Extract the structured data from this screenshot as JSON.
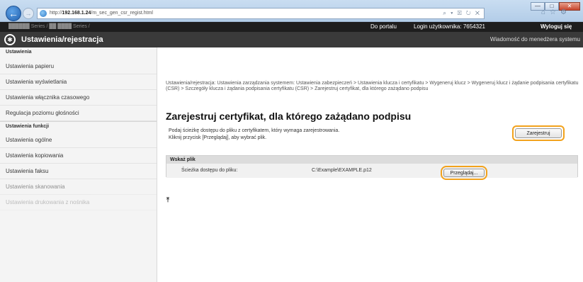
{
  "browser": {
    "url_prefix": "http://",
    "url_host": "192.168.1.24",
    "url_path": "/m_sec_gen_csr_regist.html",
    "address_tools": "⌕ ▾ ☒ ↻ ✕",
    "window_min": "—",
    "window_max": "□",
    "window_close": "✕"
  },
  "topbar": {
    "blurred_text": "██████ Series / ██ ████ Series /",
    "portal_link": "Do portalu",
    "login_label": "Login użytkownika:  7654321",
    "logout_link": "Wyloguj się"
  },
  "header": {
    "title": "Ustawienia/rejestracja",
    "message_link": "Wiadomość do menedżera systemu"
  },
  "sidebar": {
    "section_settings": "Ustawienia",
    "items_settings": [
      "Ustawienia papieru",
      "Ustawienia wyświetlania",
      "Ustawienia włącznika czasowego",
      "Regulacja poziomu głośności"
    ],
    "section_functions": "Ustawienia funkcji",
    "items_functions": [
      "Ustawienia ogólne",
      "Ustawienia kopiowania",
      "Ustawienia faksu",
      "Ustawienia skanowania",
      "Ustawienia drukowania z nośnika"
    ]
  },
  "main": {
    "breadcrumb": "Ustawienia/rejestracja: Ustawienia zarządzania systemem: Ustawienia zabezpieczeń > Ustawienia klucza i certyfikatu > Wygeneruj klucz > Wygeneruj klucz i żądanie podpisania certyfikatu (CSR) > Szczegóły klucza i żądania podpisania certyfikatu (CSR) > Zarejestruj certyfikat, dla którego zażądano podpisu",
    "page_title": "Zarejestruj certyfikat, dla którego zażądano podpisu",
    "description_line1": "Podaj ścieżkę dostępu do pliku z certyfikatem, który wymaga zarejestrowania.",
    "description_line2": "Kliknij przycisk [Przeglądaj], aby wybrać plik.",
    "register_button": "Zarejestruj",
    "panel_header": "Wskaż plik",
    "path_label": "Ścieżka dostępu do pliku:",
    "path_value": "C:\\Example\\EXAMPLE.p12",
    "browse_button": "Przeglądaj...",
    "top_icon": "⤒"
  },
  "colors": {
    "highlight": "#f2a21c",
    "header_bg": "#3a3a3a",
    "topbar_bg": "#1e1e1e"
  }
}
